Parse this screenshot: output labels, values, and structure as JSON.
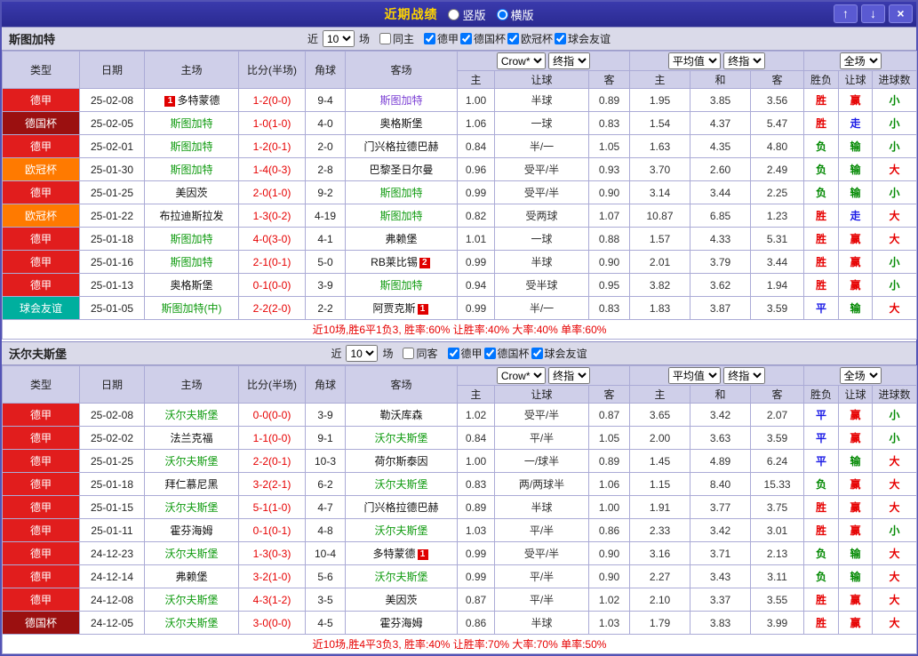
{
  "titlebar": {
    "title": "近期战绩",
    "layout_radios": [
      {
        "label": "竖版",
        "checked": false
      },
      {
        "label": "横版",
        "checked": true
      }
    ],
    "window_buttons": {
      "up": "↑",
      "down": "↓",
      "close": "×"
    }
  },
  "filter_labels": {
    "prefix": "近",
    "count": "10",
    "suffix": "场"
  },
  "table_header": {
    "static_cols": [
      "类型",
      "日期",
      "主场",
      "比分(半场)",
      "角球",
      "客场"
    ],
    "crown_group": {
      "bookmaker": "Crow*",
      "time": "终指"
    },
    "avg_group": {
      "source": "平均值",
      "time": "终指"
    },
    "result_group": {
      "scope": "全场"
    },
    "sub_cols": [
      "主",
      "让球",
      "客",
      "主",
      "和",
      "客",
      "胜负",
      "让球",
      "进球数"
    ]
  },
  "league_colors": {
    "德甲": "#e11d1d",
    "德国杯": "#9b1010",
    "欧冠杯": "#ff7a00",
    "球会友谊": "#00af9e"
  },
  "result_colors": {
    "胜": "#e60000",
    "平": "#1a1ae6",
    "负": "#008800",
    "赢": "#e60000",
    "走": "#1a1ae6",
    "输": "#008800",
    "大": "#e60000",
    "小": "#008800"
  },
  "team_colors": {
    "focal": "#109b10",
    "normal": "#111111",
    "visited": "#7b3fd4"
  },
  "sections": [
    {
      "team": "斯图加特",
      "same_venue_label": "同主",
      "same_venue_checked": false,
      "competitions": [
        {
          "label": "德甲",
          "checked": true
        },
        {
          "label": "德国杯",
          "checked": true
        },
        {
          "label": "欧冠杯",
          "checked": true
        },
        {
          "label": "球会友谊",
          "checked": true
        }
      ],
      "rows": [
        {
          "league": "德甲",
          "date": "25-02-08",
          "home": {
            "name": "多特蒙德",
            "badge_before": "1"
          },
          "score": "1-2(0-0)",
          "corners": "9-4",
          "away": {
            "name": "斯图加特",
            "color_key": "visited"
          },
          "crown": [
            "1.00",
            "半球",
            "0.89"
          ],
          "avg": [
            "1.95",
            "3.85",
            "3.56"
          ],
          "outcome": "胜",
          "handicap_result": "赢",
          "goals_result": "小"
        },
        {
          "league": "德国杯",
          "date": "25-02-05",
          "home": {
            "name": "斯图加特",
            "color_key": "focal"
          },
          "score": "1-0(1-0)",
          "corners": "4-0",
          "away": {
            "name": "奥格斯堡"
          },
          "crown": [
            "1.06",
            "一球",
            "0.83"
          ],
          "avg": [
            "1.54",
            "4.37",
            "5.47"
          ],
          "outcome": "胜",
          "handicap_result": "走",
          "goals_result": "小"
        },
        {
          "league": "德甲",
          "date": "25-02-01",
          "home": {
            "name": "斯图加特",
            "color_key": "focal"
          },
          "score": "1-2(0-1)",
          "corners": "2-0",
          "away": {
            "name": "门兴格拉德巴赫"
          },
          "crown": [
            "0.84",
            "半/一",
            "1.05"
          ],
          "avg": [
            "1.63",
            "4.35",
            "4.80"
          ],
          "outcome": "负",
          "handicap_result": "输",
          "goals_result": "小"
        },
        {
          "league": "欧冠杯",
          "date": "25-01-30",
          "home": {
            "name": "斯图加特",
            "color_key": "focal"
          },
          "score": "1-4(0-3)",
          "corners": "2-8",
          "away": {
            "name": "巴黎圣日尔曼"
          },
          "crown": [
            "0.96",
            "受平/半",
            "0.93"
          ],
          "avg": [
            "3.70",
            "2.60",
            "2.49"
          ],
          "outcome": "负",
          "handicap_result": "输",
          "goals_result": "大"
        },
        {
          "league": "德甲",
          "date": "25-01-25",
          "home": {
            "name": "美因茨"
          },
          "score": "2-0(1-0)",
          "corners": "9-2",
          "away": {
            "name": "斯图加特",
            "color_key": "focal"
          },
          "crown": [
            "0.99",
            "受平/半",
            "0.90"
          ],
          "avg": [
            "3.14",
            "3.44",
            "2.25"
          ],
          "outcome": "负",
          "handicap_result": "输",
          "goals_result": "小"
        },
        {
          "league": "欧冠杯",
          "date": "25-01-22",
          "home": {
            "name": "布拉迪斯拉发"
          },
          "score": "1-3(0-2)",
          "corners": "4-19",
          "away": {
            "name": "斯图加特",
            "color_key": "focal"
          },
          "crown": [
            "0.82",
            "受两球",
            "1.07"
          ],
          "avg": [
            "10.87",
            "6.85",
            "1.23"
          ],
          "outcome": "胜",
          "handicap_result": "走",
          "goals_result": "大"
        },
        {
          "league": "德甲",
          "date": "25-01-18",
          "home": {
            "name": "斯图加特",
            "color_key": "focal"
          },
          "score": "4-0(3-0)",
          "corners": "4-1",
          "away": {
            "name": "弗赖堡"
          },
          "crown": [
            "1.01",
            "一球",
            "0.88"
          ],
          "avg": [
            "1.57",
            "4.33",
            "5.31"
          ],
          "outcome": "胜",
          "handicap_result": "赢",
          "goals_result": "大"
        },
        {
          "league": "德甲",
          "date": "25-01-16",
          "home": {
            "name": "斯图加特",
            "color_key": "focal"
          },
          "score": "2-1(0-1)",
          "corners": "5-0",
          "away": {
            "name": "RB莱比锡",
            "badge_after": "2"
          },
          "crown": [
            "0.99",
            "半球",
            "0.90"
          ],
          "avg": [
            "2.01",
            "3.79",
            "3.44"
          ],
          "outcome": "胜",
          "handicap_result": "赢",
          "goals_result": "小"
        },
        {
          "league": "德甲",
          "date": "25-01-13",
          "home": {
            "name": "奥格斯堡"
          },
          "score": "0-1(0-0)",
          "corners": "3-9",
          "away": {
            "name": "斯图加特",
            "color_key": "focal"
          },
          "crown": [
            "0.94",
            "受半球",
            "0.95"
          ],
          "avg": [
            "3.82",
            "3.62",
            "1.94"
          ],
          "outcome": "胜",
          "handicap_result": "赢",
          "goals_result": "小"
        },
        {
          "league": "球会友谊",
          "date": "25-01-05",
          "home": {
            "name": "斯图加特(中)",
            "color_key": "focal"
          },
          "score": "2-2(2-0)",
          "corners": "2-2",
          "away": {
            "name": "阿贾克斯",
            "badge_after": "1"
          },
          "crown": [
            "0.99",
            "半/一",
            "0.83"
          ],
          "avg": [
            "1.83",
            "3.87",
            "3.59"
          ],
          "outcome": "平",
          "handicap_result": "输",
          "goals_result": "大"
        }
      ],
      "summary": "近10场,胜6平1负3, 胜率:60% 让胜率:40% 大率:40% 单率:60%"
    },
    {
      "team": "沃尔夫斯堡",
      "same_venue_label": "同客",
      "same_venue_checked": false,
      "competitions": [
        {
          "label": "德甲",
          "checked": true
        },
        {
          "label": "德国杯",
          "checked": true
        },
        {
          "label": "球会友谊",
          "checked": true
        }
      ],
      "rows": [
        {
          "league": "德甲",
          "date": "25-02-08",
          "home": {
            "name": "沃尔夫斯堡",
            "color_key": "focal"
          },
          "score": "0-0(0-0)",
          "corners": "3-9",
          "away": {
            "name": "勒沃库森"
          },
          "crown": [
            "1.02",
            "受平/半",
            "0.87"
          ],
          "avg": [
            "3.65",
            "3.42",
            "2.07"
          ],
          "outcome": "平",
          "handicap_result": "赢",
          "goals_result": "小"
        },
        {
          "league": "德甲",
          "date": "25-02-02",
          "home": {
            "name": "法兰克福"
          },
          "score": "1-1(0-0)",
          "corners": "9-1",
          "away": {
            "name": "沃尔夫斯堡",
            "color_key": "focal"
          },
          "crown": [
            "0.84",
            "平/半",
            "1.05"
          ],
          "avg": [
            "2.00",
            "3.63",
            "3.59"
          ],
          "outcome": "平",
          "handicap_result": "赢",
          "goals_result": "小"
        },
        {
          "league": "德甲",
          "date": "25-01-25",
          "home": {
            "name": "沃尔夫斯堡",
            "color_key": "focal"
          },
          "score": "2-2(0-1)",
          "corners": "10-3",
          "away": {
            "name": "荷尔斯泰因"
          },
          "crown": [
            "1.00",
            "一/球半",
            "0.89"
          ],
          "avg": [
            "1.45",
            "4.89",
            "6.24"
          ],
          "outcome": "平",
          "handicap_result": "输",
          "goals_result": "大"
        },
        {
          "league": "德甲",
          "date": "25-01-18",
          "home": {
            "name": "拜仁慕尼黑"
          },
          "score": "3-2(2-1)",
          "corners": "6-2",
          "away": {
            "name": "沃尔夫斯堡",
            "color_key": "focal"
          },
          "crown": [
            "0.83",
            "两/两球半",
            "1.06"
          ],
          "avg": [
            "1.15",
            "8.40",
            "15.33"
          ],
          "outcome": "负",
          "handicap_result": "赢",
          "goals_result": "大"
        },
        {
          "league": "德甲",
          "date": "25-01-15",
          "home": {
            "name": "沃尔夫斯堡",
            "color_key": "focal"
          },
          "score": "5-1(1-0)",
          "corners": "4-7",
          "away": {
            "name": "门兴格拉德巴赫"
          },
          "crown": [
            "0.89",
            "半球",
            "1.00"
          ],
          "avg": [
            "1.91",
            "3.77",
            "3.75"
          ],
          "outcome": "胜",
          "handicap_result": "赢",
          "goals_result": "大"
        },
        {
          "league": "德甲",
          "date": "25-01-11",
          "home": {
            "name": "霍芬海姆"
          },
          "score": "0-1(0-1)",
          "corners": "4-8",
          "away": {
            "name": "沃尔夫斯堡",
            "color_key": "focal"
          },
          "crown": [
            "1.03",
            "平/半",
            "0.86"
          ],
          "avg": [
            "2.33",
            "3.42",
            "3.01"
          ],
          "outcome": "胜",
          "handicap_result": "赢",
          "goals_result": "小"
        },
        {
          "league": "德甲",
          "date": "24-12-23",
          "home": {
            "name": "沃尔夫斯堡",
            "color_key": "focal"
          },
          "score": "1-3(0-3)",
          "corners": "10-4",
          "away": {
            "name": "多特蒙德",
            "badge_after": "1"
          },
          "crown": [
            "0.99",
            "受平/半",
            "0.90"
          ],
          "avg": [
            "3.16",
            "3.71",
            "2.13"
          ],
          "outcome": "负",
          "handicap_result": "输",
          "goals_result": "大"
        },
        {
          "league": "德甲",
          "date": "24-12-14",
          "home": {
            "name": "弗赖堡"
          },
          "score": "3-2(1-0)",
          "corners": "5-6",
          "away": {
            "name": "沃尔夫斯堡",
            "color_key": "focal"
          },
          "crown": [
            "0.99",
            "平/半",
            "0.90"
          ],
          "avg": [
            "2.27",
            "3.43",
            "3.11"
          ],
          "outcome": "负",
          "handicap_result": "输",
          "goals_result": "大"
        },
        {
          "league": "德甲",
          "date": "24-12-08",
          "home": {
            "name": "沃尔夫斯堡",
            "color_key": "focal"
          },
          "score": "4-3(1-2)",
          "corners": "3-5",
          "away": {
            "name": "美因茨"
          },
          "crown": [
            "0.87",
            "平/半",
            "1.02"
          ],
          "avg": [
            "2.10",
            "3.37",
            "3.55"
          ],
          "outcome": "胜",
          "handicap_result": "赢",
          "goals_result": "大"
        },
        {
          "league": "德国杯",
          "date": "24-12-05",
          "home": {
            "name": "沃尔夫斯堡",
            "color_key": "focal"
          },
          "score": "3-0(0-0)",
          "corners": "4-5",
          "away": {
            "name": "霍芬海姆"
          },
          "crown": [
            "0.86",
            "半球",
            "1.03"
          ],
          "avg": [
            "1.79",
            "3.83",
            "3.99"
          ],
          "outcome": "胜",
          "handicap_result": "赢",
          "goals_result": "大"
        }
      ],
      "summary": "近10场,胜4平3负3, 胜率:40% 让胜率:70% 大率:70% 单率:50%"
    }
  ]
}
